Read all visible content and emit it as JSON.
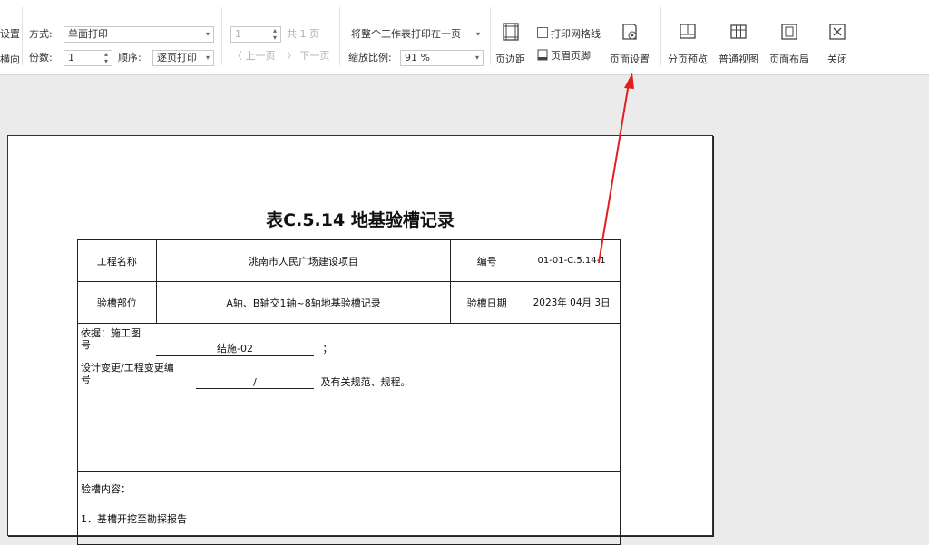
{
  "toolbar": {
    "setup_partial": "设置",
    "orientation_partial": "横向",
    "mode_label": "方式:",
    "mode_value": "单面打印",
    "copies_label": "份数:",
    "copies_value": "1",
    "order_label": "顺序:",
    "order_value": "逐页打印",
    "page_number": "1",
    "total_pages": "共 1 页",
    "prev_page": "上一页",
    "next_page": "下一页",
    "fit_value": "将整个工作表打印在一页",
    "zoom_label": "缩放比例:",
    "zoom_value": "91 %",
    "margins": "页边距",
    "print_gridlines": "打印网格线",
    "header_footer": "页眉页脚",
    "page_setup": "页面设置",
    "page_break_preview": "分页预览",
    "normal_view": "普通视图",
    "page_layout": "页面布局",
    "close": "关闭"
  },
  "document": {
    "title": "表C.5.14 地基验槽记录",
    "project_label": "工程名称",
    "project_value": "洮南市人民广场建设项目",
    "code_label": "编号",
    "code_value": "01-01-C.5.14-1",
    "part_label": "验槽部位",
    "part_value": "A轴、B轴交1轴~8轴地基验槽记录",
    "date_label": "验槽日期",
    "date_value": "2023年 04月 3日",
    "basis_label_1": "依据：施工图",
    "basis_label_2": "号",
    "drawing_no": "结施-02",
    "basis_semicolon": "；",
    "change_label_1": "设计变更/工程变更编",
    "change_label_2": "号",
    "change_no": "/",
    "basis_suffix": "及有关规范、规程。",
    "content_label": "验槽内容：",
    "item_1": "1．基槽开挖至勘探报告"
  },
  "colors": {
    "arrow": "#e02020",
    "toolbar_bg": "#ffffff",
    "workspace_bg": "#ebebeb"
  }
}
